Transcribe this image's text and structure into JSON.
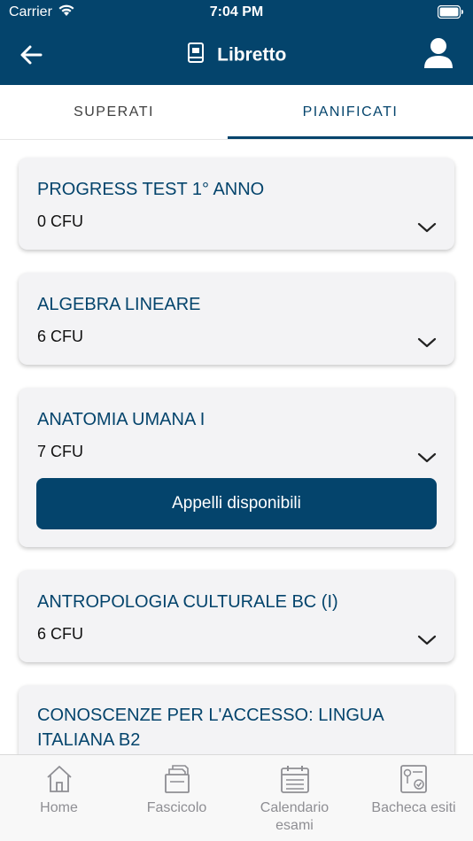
{
  "status_bar": {
    "carrier": "Carrier",
    "time": "7:04 PM"
  },
  "header": {
    "title": "Libretto",
    "back_icon": "arrow-left-icon",
    "title_icon": "booklet-icon",
    "user_icon": "user-icon"
  },
  "tabs": [
    {
      "label": "SUPERATI",
      "selected": false
    },
    {
      "label": "PIANIFICATI",
      "selected": true
    }
  ],
  "exams": [
    {
      "title": "PROGRESS TEST 1° ANNO",
      "cfu": "0 CFU"
    },
    {
      "title": "ALGEBRA LINEARE",
      "cfu": "6 CFU"
    },
    {
      "title": "ANATOMIA UMANA I",
      "cfu": "7 CFU",
      "button": "Appelli disponibili"
    },
    {
      "title": "ANTROPOLOGIA CULTURALE BC (I)",
      "cfu": "6 CFU"
    },
    {
      "title_line1": "CONOSCENZE PER L'ACCESSO: LINGUA",
      "title_line2": "ITALIANA B2"
    }
  ],
  "bottom_nav": [
    {
      "label": "Home",
      "icon": "home-icon"
    },
    {
      "label": "Fascicolo",
      "icon": "folder-icon"
    },
    {
      "label_line1": "Calendario",
      "label_line2": "esami",
      "icon": "calendar-icon"
    },
    {
      "label": "Bacheca esiti",
      "icon": "results-board-icon"
    }
  ],
  "colors": {
    "primary": "#04446c",
    "card_bg": "#f3f3f5",
    "nav_gray": "#8e8e93"
  }
}
